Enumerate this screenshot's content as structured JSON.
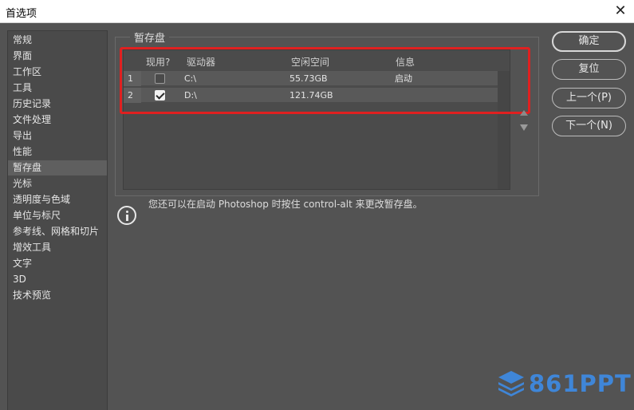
{
  "window": {
    "title": "首选项",
    "close_symbol": "✕"
  },
  "sidebar": {
    "items": [
      {
        "label": "常规"
      },
      {
        "label": "界面"
      },
      {
        "label": "工作区"
      },
      {
        "label": "工具"
      },
      {
        "label": "历史记录"
      },
      {
        "label": "文件处理"
      },
      {
        "label": "导出"
      },
      {
        "label": "性能"
      },
      {
        "label": "暂存盘",
        "selected": true
      },
      {
        "label": "光标"
      },
      {
        "label": "透明度与色域"
      },
      {
        "label": "单位与标尺"
      },
      {
        "label": "参考线、网格和切片"
      },
      {
        "label": "增效工具"
      },
      {
        "label": "文字"
      },
      {
        "label": "3D"
      },
      {
        "label": "技术预览"
      }
    ]
  },
  "scratch": {
    "group_title": "暂存盘",
    "columns": [
      "现用?",
      "驱动器",
      "空闲空间",
      "信息"
    ],
    "rows": [
      {
        "index": "1",
        "active": false,
        "drive": "C:\\",
        "free": "55.73GB",
        "info": "启动"
      },
      {
        "index": "2",
        "active": true,
        "drive": "D:\\",
        "free": "121.74GB",
        "info": ""
      }
    ]
  },
  "info_text": "您还可以在启动 Photoshop 时按住 control-alt 来更改暂存盘。",
  "buttons": {
    "ok": "确定",
    "reset": "复位",
    "prev": "上一个(P)",
    "next": "下一个(N)"
  },
  "watermark": {
    "text": "861PPT"
  },
  "colors": {
    "highlight": "#e02020",
    "watermark": "#3f86d8",
    "panel": "#535353"
  }
}
